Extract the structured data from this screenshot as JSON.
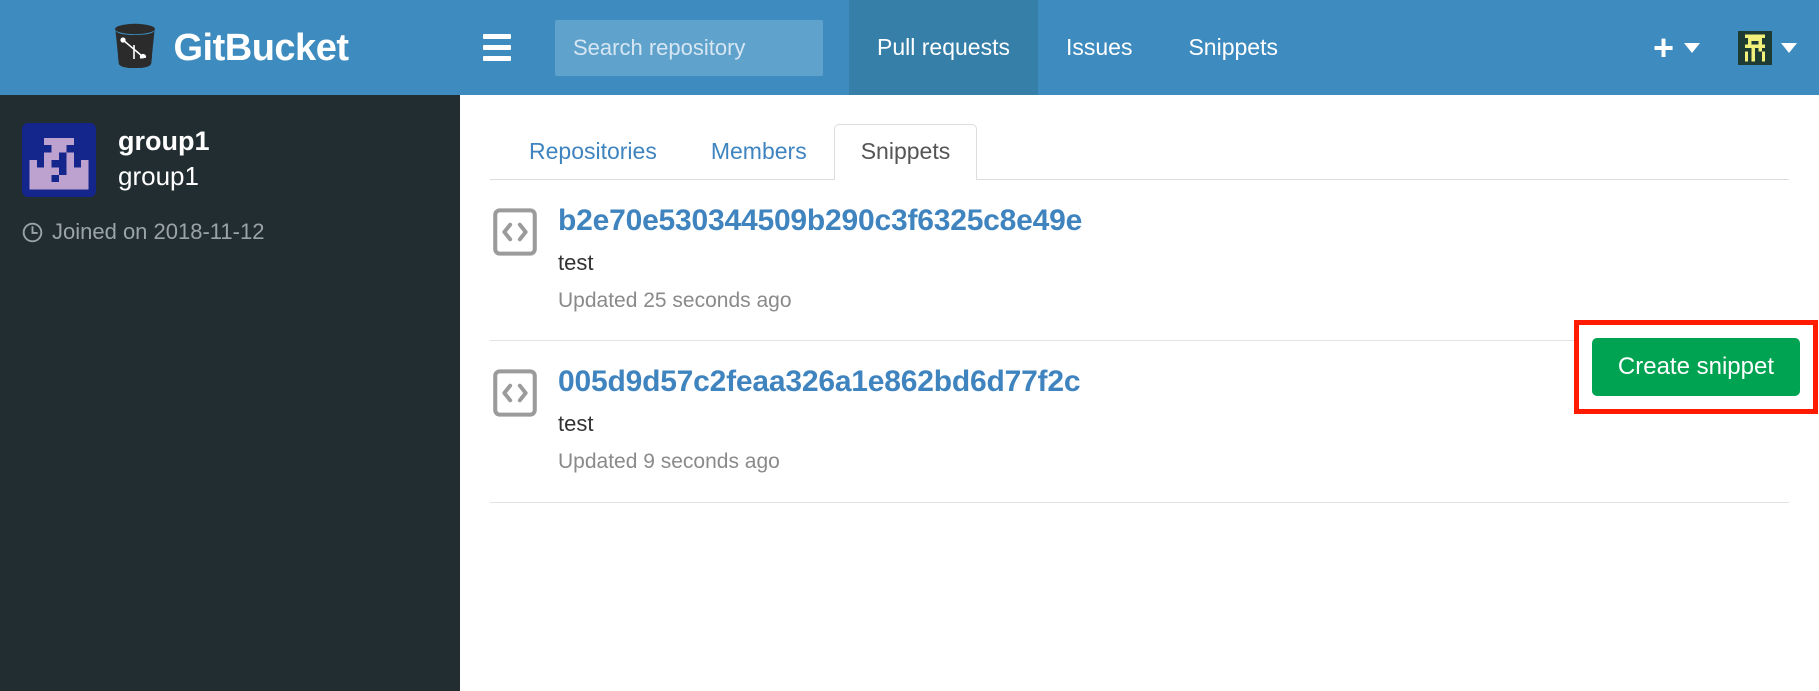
{
  "header": {
    "brand": "GitBucket",
    "brand_logo_icon": "gitbucket-logo-icon",
    "menu_icon": "hamburger-menu-icon",
    "search": {
      "placeholder": "Search repository",
      "value": "",
      "icon": "search-input"
    },
    "nav_items": [
      {
        "label": "Pull requests",
        "active": true
      },
      {
        "label": "Issues",
        "active": false
      },
      {
        "label": "Snippets",
        "active": false
      }
    ],
    "plus_menu": {
      "icon": "plus-icon",
      "caret_icon": "chevron-down-icon"
    },
    "user_menu": {
      "avatar_icon": "user-avatar-identicon",
      "caret_icon": "chevron-down-icon"
    },
    "colors": {
      "bar_bg": "#3e8bbf",
      "active_bg": "#357fa8",
      "search_bg": "#5fa2cc"
    }
  },
  "sidebar": {
    "avatar_icon": "group-avatar-identicon",
    "group_name": "group1",
    "group_fullname": "group1",
    "joined": {
      "icon": "clock-icon",
      "text": "Joined on 2018-11-12"
    },
    "colors": {
      "bg": "#222d32"
    }
  },
  "main": {
    "tabs": [
      {
        "label": "Repositories",
        "active": false
      },
      {
        "label": "Members",
        "active": false
      },
      {
        "label": "Snippets",
        "active": true
      }
    ],
    "create_button": {
      "label": "Create snippet",
      "color": "#00a352",
      "highlight_color": "#ff1a00",
      "highlighted": true
    },
    "snippets": [
      {
        "icon": "code-file-icon",
        "id": "b2e70e530344509b290c3f6325c8e49e",
        "description": "test",
        "updated": "Updated 25 seconds ago"
      },
      {
        "icon": "code-file-icon",
        "id": "005d9d57c2feaa326a1e862bd6d77f2c",
        "description": "test",
        "updated": "Updated 9 seconds ago"
      }
    ]
  }
}
